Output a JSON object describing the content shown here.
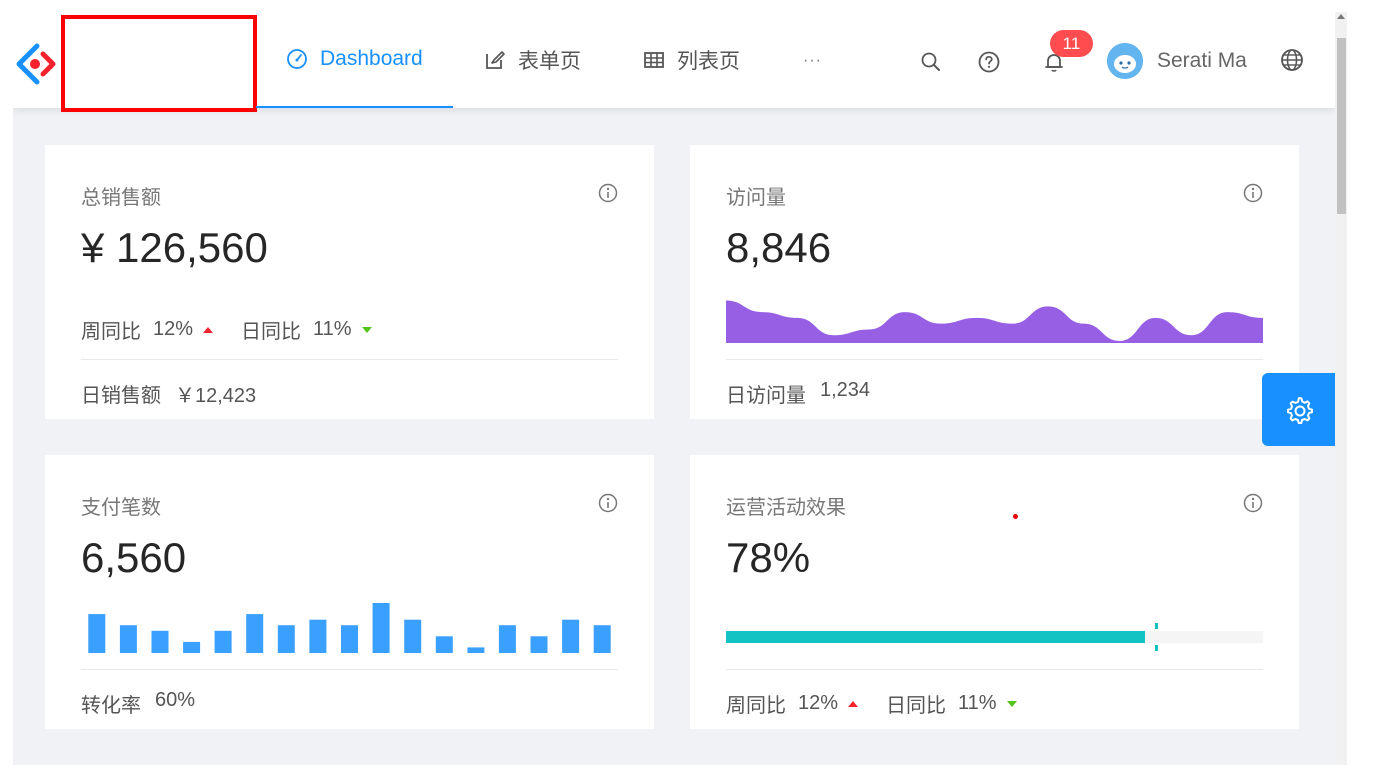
{
  "header": {
    "nav": [
      {
        "label": "Dashboard",
        "icon": "dashboard-icon",
        "active": true
      },
      {
        "label": "表单页",
        "icon": "form-edit-icon",
        "active": false
      },
      {
        "label": "列表页",
        "icon": "table-icon",
        "active": false
      }
    ],
    "more_label": "···",
    "notification_count": "11",
    "user_name": "Serati Ma",
    "icons": [
      "search-icon",
      "help-icon",
      "bell-icon",
      "globe-icon"
    ]
  },
  "cards": {
    "sales": {
      "title": "总销售额",
      "value": "¥ 126,560",
      "week_label": "周同比",
      "week_value": "12%",
      "day_label": "日同比",
      "day_value": "11%",
      "footer_label": "日销售额",
      "footer_value": "￥12,423"
    },
    "visits": {
      "title": "访问量",
      "value": "8,846",
      "footer_label": "日访问量",
      "footer_value": "1,234"
    },
    "payments": {
      "title": "支付笔数",
      "value": "6,560",
      "footer_label": "转化率",
      "footer_value": "60%"
    },
    "operations": {
      "title": "运营活动效果",
      "value": "78%",
      "progress_percent": 78,
      "target_percent": 80,
      "week_label": "周同比",
      "week_value": "12%",
      "day_label": "日同比",
      "day_value": "11%"
    }
  },
  "chart_data": [
    {
      "type": "area",
      "series": [
        {
          "values": [
            7,
            5,
            4,
            1,
            2,
            5,
            3,
            4,
            3,
            6,
            3,
            0,
            4,
            1,
            5,
            4
          ]
        }
      ],
      "ylim": [
        0,
        9
      ],
      "color": "#975fe4"
    },
    {
      "type": "bar",
      "series": [
        {
          "values": [
            7,
            5,
            4,
            2,
            4,
            7,
            5,
            6,
            5,
            9,
            6,
            3,
            1,
            5,
            3,
            6,
            5
          ]
        }
      ],
      "ylim": [
        0,
        9
      ],
      "color": "#3aa0ff"
    }
  ],
  "colors": {
    "primary": "#1890ff",
    "badge": "#ff4d4f",
    "up": "#f5222d",
    "down": "#52c41a",
    "progress": "#13c2c2"
  }
}
